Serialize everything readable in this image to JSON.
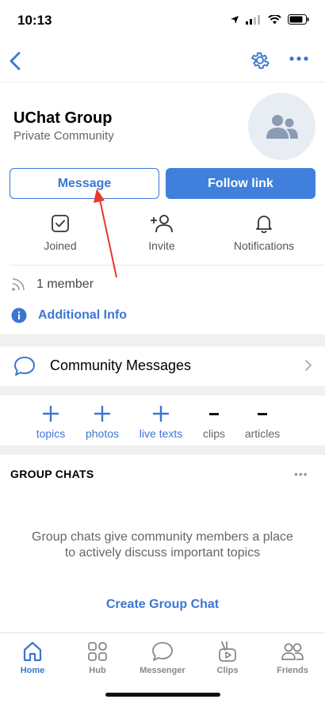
{
  "status_bar": {
    "time": "10:13"
  },
  "community": {
    "name": "UChat Group",
    "type": "Private Community"
  },
  "buttons": {
    "message": "Message",
    "follow_link": "Follow link"
  },
  "actions": [
    {
      "label": "Joined",
      "icon": "checkbox-icon"
    },
    {
      "label": "Invite",
      "icon": "add-person-icon"
    },
    {
      "label": "Notifications",
      "icon": "bell-icon"
    }
  ],
  "members": "1 member",
  "additional_info": "Additional Info",
  "community_messages": "Community Messages",
  "counts": [
    {
      "symbol": "+",
      "label": "topics"
    },
    {
      "symbol": "+",
      "label": "photos"
    },
    {
      "symbol": "+",
      "label": "live texts"
    },
    {
      "symbol": "–",
      "label": "clips"
    },
    {
      "symbol": "–",
      "label": "articles"
    }
  ],
  "group_chats": {
    "header": "GROUP CHATS",
    "menu": "•••",
    "description": "Group chats give community members a place to actively discuss important topics",
    "create": "Create Group Chat"
  },
  "tabs": [
    {
      "label": "Home",
      "icon": "home-icon",
      "active": true
    },
    {
      "label": "Hub",
      "icon": "grid-icon"
    },
    {
      "label": "Messenger",
      "icon": "chat-icon"
    },
    {
      "label": "Clips",
      "icon": "clips-icon"
    },
    {
      "label": "Friends",
      "icon": "friends-icon"
    }
  ],
  "colors": {
    "accent": "#3b76d2",
    "button_fill": "#4080dc",
    "separator": "#f0f0f0",
    "annotation": "#e8392b"
  }
}
